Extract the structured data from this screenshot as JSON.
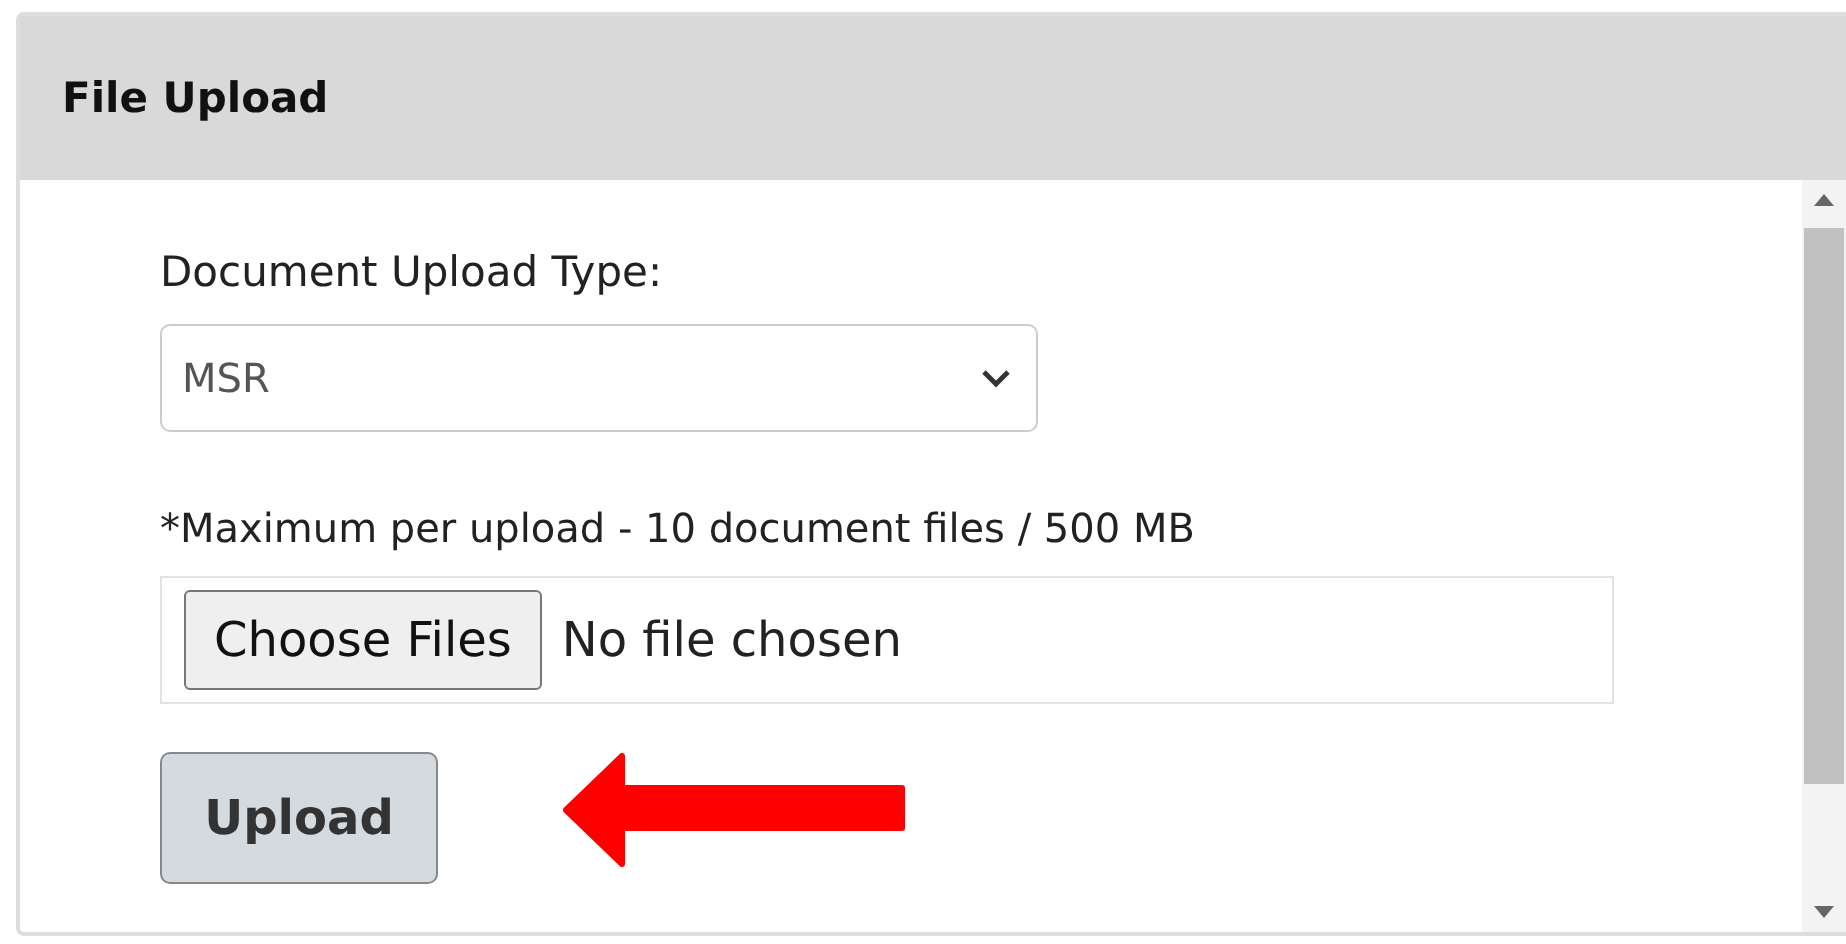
{
  "panel": {
    "title": "File Upload"
  },
  "document_type": {
    "label": "Document Upload Type:",
    "value": "MSR"
  },
  "note": "*Maximum per upload - 10 document files / 500 MB",
  "file_input": {
    "button": "Choose Files",
    "status": "No file chosen"
  },
  "upload_button": {
    "label": "Upload"
  }
}
